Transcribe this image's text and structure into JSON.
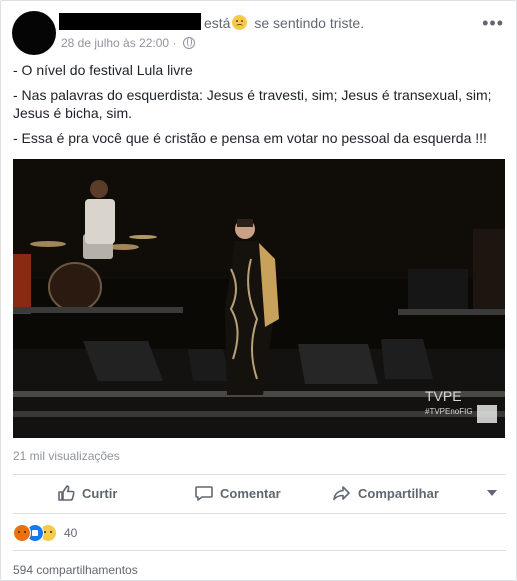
{
  "header": {
    "status_text": "está",
    "feeling_icon": "sad-face-icon",
    "feeling_text": "se sentindo triste.",
    "timestamp": "28 de julho às 22:00",
    "separator": "·",
    "audience_icon": "globe-icon",
    "more_icon": "•••"
  },
  "post": {
    "lines": [
      "- O nível do festival Lula livre",
      "- Nas palavras do esquerdista: Jesus é travesti, sim; Jesus é transexual, sim; Jesus é bicha, sim.",
      "- Essa é pra você que é cristão e pensa em votar no pessoal da esquerda !!!"
    ]
  },
  "video": {
    "watermark_brand": "TVPE",
    "watermark_tag": "#TVPEnoFIG",
    "views": "21 mil visualizações"
  },
  "actions": {
    "like_label": "Curtir",
    "comment_label": "Comentar",
    "share_label": "Compartilhar"
  },
  "footer": {
    "reaction_icons": [
      "angry-icon",
      "like-icon",
      "sad-icon"
    ],
    "reaction_count": "40",
    "shares": "594 compartilhamentos"
  },
  "colors": {
    "text": "#1d2129",
    "muted": "#90949c",
    "action": "#606770",
    "video_bg": "#0b0906"
  }
}
